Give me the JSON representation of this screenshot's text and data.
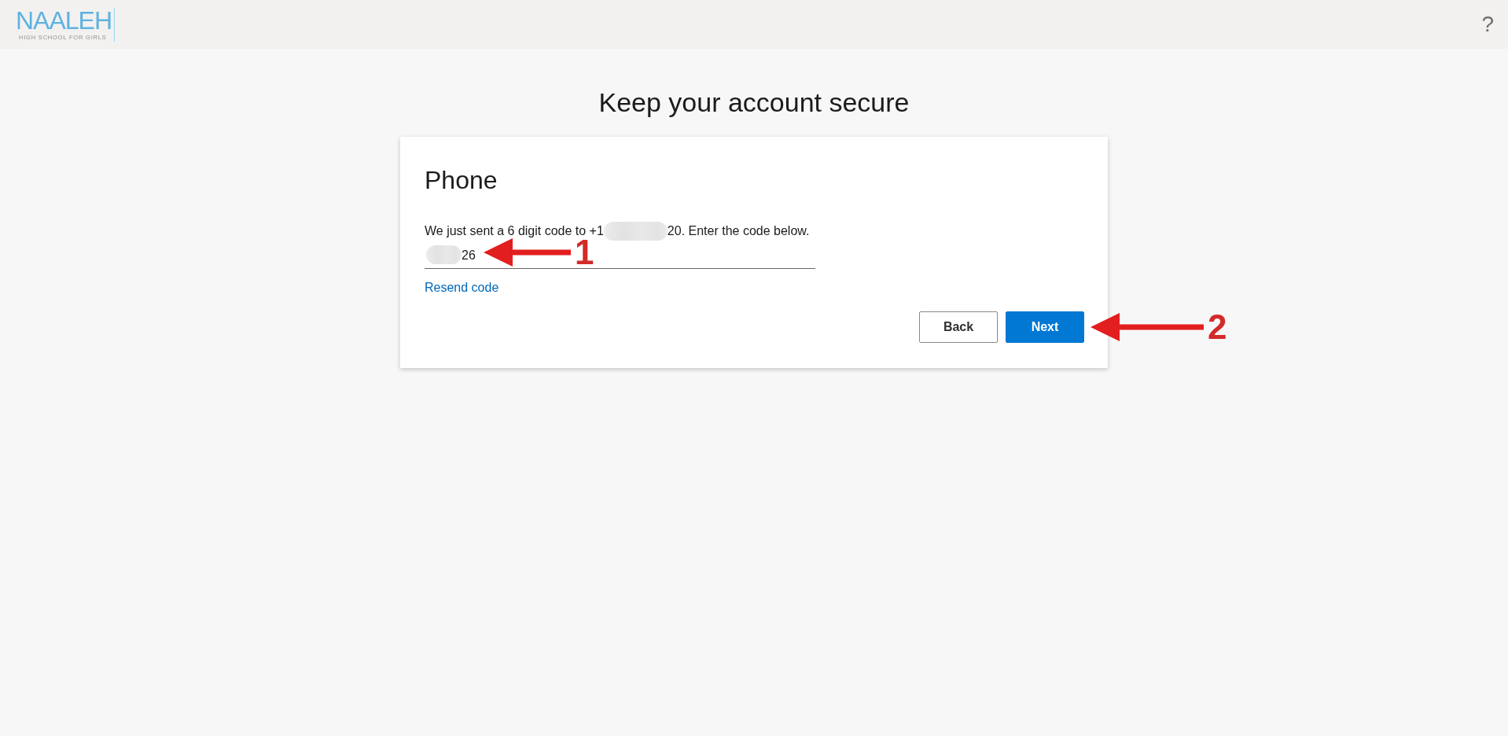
{
  "header": {
    "logo": {
      "wordmark": "NAALEH",
      "tagline": "HIGH SCHOOL FOR GIRLS"
    },
    "help": "?"
  },
  "page_title": "Keep your account secure",
  "card": {
    "heading": "Phone",
    "message": {
      "before": "We just sent a 6 digit code to +1",
      "redacted": true,
      "after": "20. Enter the code below."
    },
    "code_input": {
      "value": "26",
      "redacted": true,
      "annotation": "1"
    },
    "resend_link": "Resend code",
    "buttons": [
      {
        "label": "Back",
        "kind": "secondary"
      },
      {
        "label": "Next",
        "kind": "primary",
        "annotation": "2"
      }
    ]
  }
}
